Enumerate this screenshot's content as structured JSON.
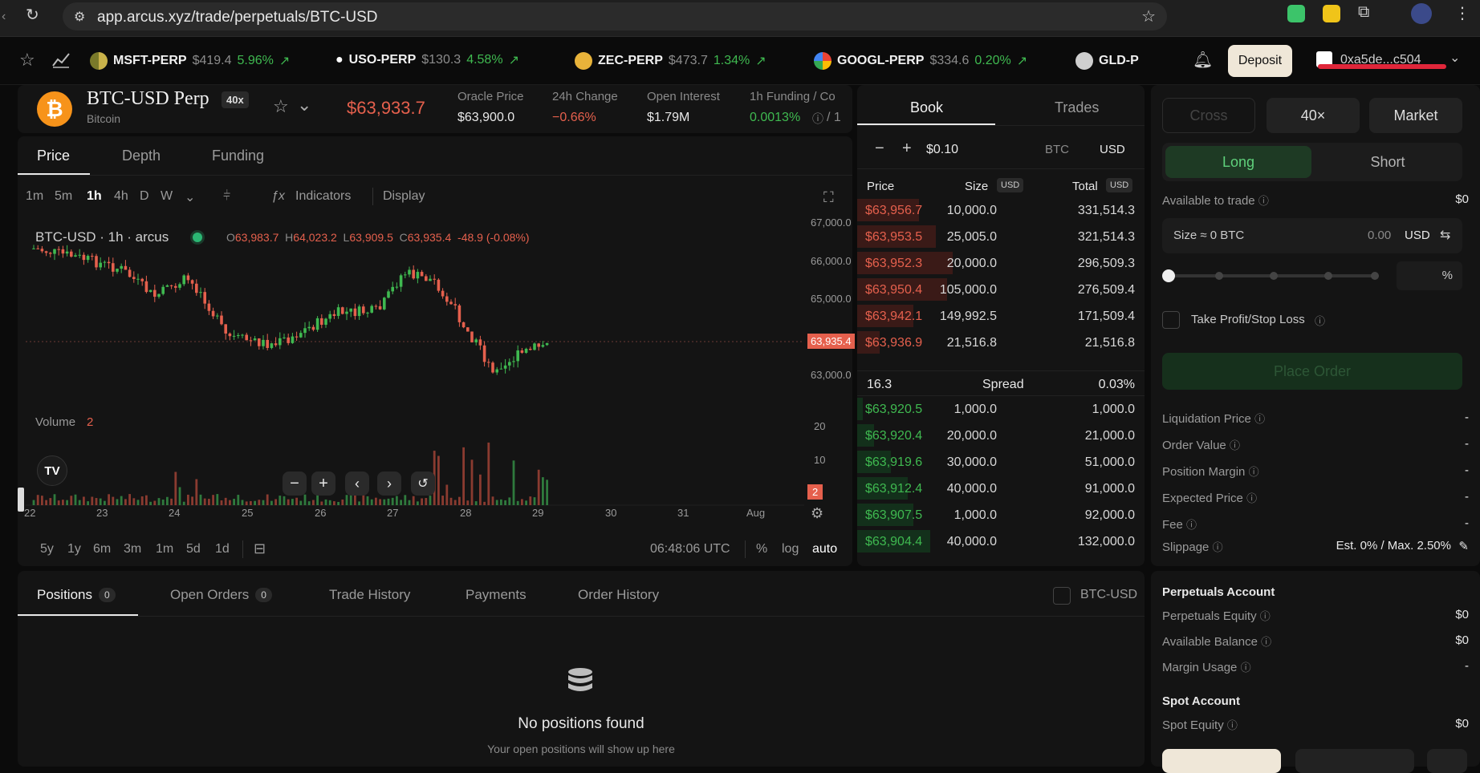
{
  "browser": {
    "url": "app.arcus.xyz/trade/perpetuals/BTC-USD"
  },
  "ticker": [
    {
      "symbol": "MSFT-PERP",
      "price": "$419.4",
      "change": "5.96%"
    },
    {
      "symbol": "USO-PERP",
      "price": "$130.3",
      "change": "4.58%"
    },
    {
      "symbol": "ZEC-PERP",
      "price": "$473.7",
      "change": "1.34%"
    },
    {
      "symbol": "GOOGL-PERP",
      "price": "$334.6",
      "change": "0.20%"
    },
    {
      "symbol": "GLD-P",
      "price": "",
      "change": ""
    }
  ],
  "header": {
    "deposit_label": "Deposit",
    "account": "0xa5de...c504"
  },
  "market": {
    "title": "BTC-USD Perp",
    "subtitle": "Bitcoin",
    "leverage": "40x",
    "price": "$63,933.7",
    "stats": [
      {
        "label": "Oracle Price",
        "value": "$63,900.0"
      },
      {
        "label": "24h Change",
        "value": "−0.66%"
      },
      {
        "label": "Open Interest",
        "value": "$1.79M"
      },
      {
        "label": "1h Funding / Co",
        "value": "0.0013%"
      }
    ],
    "funding_suffix": "/ 1"
  },
  "chart": {
    "tabs": [
      "Price",
      "Depth",
      "Funding"
    ],
    "timeframes": [
      "1m",
      "5m",
      "1h",
      "4h",
      "D",
      "W"
    ],
    "indicators_label": "Indicators",
    "display_label": "Display",
    "legend_title": "BTC-USD · 1h · arcus",
    "ohlc": {
      "o": "63,983.7",
      "h": "64,023.2",
      "l": "63,909.5",
      "c": "63,935.4",
      "chg": "-48.9 (-0.08%)"
    },
    "volume_label": "Volume",
    "volume_value": "2",
    "price_tag": "63,935.4",
    "volume_tag": "2",
    "y_ticks": [
      "67,000.0",
      "66,000.0",
      "65,000.0",
      "63,000.0"
    ],
    "vol_ticks": [
      "20",
      "10"
    ],
    "x_ticks": [
      "22",
      "23",
      "24",
      "25",
      "26",
      "27",
      "28",
      "29",
      "30",
      "31",
      "Aug"
    ],
    "ranges": [
      "5y",
      "1y",
      "6m",
      "3m",
      "1m",
      "5d",
      "1d"
    ],
    "time": "06:48:06 UTC",
    "scale_opts": [
      "%",
      "log",
      "auto"
    ]
  },
  "book": {
    "tabs": [
      "Book",
      "Trades"
    ],
    "tick": "$0.10",
    "units": [
      "BTC",
      "USD"
    ],
    "columns": {
      "price": "Price",
      "size": "Size",
      "total": "Total",
      "unit": "USD"
    },
    "asks": [
      {
        "price": "$63,956.7",
        "size": "10,000.0",
        "total": "331,514.3"
      },
      {
        "price": "$63,953.5",
        "size": "25,005.0",
        "total": "321,514.3"
      },
      {
        "price": "$63,952.3",
        "size": "20,000.0",
        "total": "296,509.3"
      },
      {
        "price": "$63,950.4",
        "size": "105,000.0",
        "total": "276,509.4"
      },
      {
        "price": "$63,942.1",
        "size": "149,992.5",
        "total": "171,509.4"
      },
      {
        "price": "$63,936.9",
        "size": "21,516.8",
        "total": "21,516.8"
      }
    ],
    "spread": {
      "value": "16.3",
      "label": "Spread",
      "pct": "0.03%"
    },
    "bids": [
      {
        "price": "$63,920.5",
        "size": "1,000.0",
        "total": "1,000.0"
      },
      {
        "price": "$63,920.4",
        "size": "20,000.0",
        "total": "21,000.0"
      },
      {
        "price": "$63,919.6",
        "size": "30,000.0",
        "total": "51,000.0"
      },
      {
        "price": "$63,912.4",
        "size": "40,000.0",
        "total": "91,000.0"
      },
      {
        "price": "$63,907.5",
        "size": "1,000.0",
        "total": "92,000.0"
      },
      {
        "price": "$63,904.4",
        "size": "40,000.0",
        "total": "132,000.0"
      }
    ]
  },
  "form": {
    "margin_modes": [
      "Cross",
      "40×",
      "Market"
    ],
    "sides": [
      "Long",
      "Short"
    ],
    "available_label": "Available to trade",
    "available_value": "$0",
    "size_label": "Size ≈ 0 BTC",
    "size_value": "0.00",
    "size_unit": "USD",
    "pct": "%",
    "tpsl_label": "Take Profit/Stop Loss",
    "place_order": "Place Order",
    "details": [
      {
        "label": "Liquidation Price",
        "value": "-"
      },
      {
        "label": "Order Value",
        "value": "-"
      },
      {
        "label": "Position Margin",
        "value": "-"
      },
      {
        "label": "Expected Price",
        "value": "-"
      },
      {
        "label": "Fee",
        "value": "-"
      }
    ],
    "slippage_label": "Slippage",
    "slippage_value": "Est. 0% / Max. 2.50%"
  },
  "bottom": {
    "tabs": [
      {
        "label": "Positions",
        "count": "0"
      },
      {
        "label": "Open Orders",
        "count": "0"
      },
      {
        "label": "Trade History"
      },
      {
        "label": "Payments"
      },
      {
        "label": "Order History"
      }
    ],
    "filter_label": "BTC-USD",
    "empty_title": "No positions found",
    "empty_sub": "Your open positions will show up here"
  },
  "account": {
    "perp_title": "Perpetuals Account",
    "perp_rows": [
      {
        "label": "Perpetuals Equity",
        "value": "$0"
      },
      {
        "label": "Available Balance",
        "value": "$0"
      },
      {
        "label": "Margin Usage",
        "value": "-"
      }
    ],
    "spot_title": "Spot Account",
    "spot_rows": [
      {
        "label": "Spot Equity",
        "value": "$0"
      }
    ]
  },
  "colors": {
    "up": "#3fb950",
    "down": "#e5604d",
    "accent_long": "#1e3a24"
  }
}
